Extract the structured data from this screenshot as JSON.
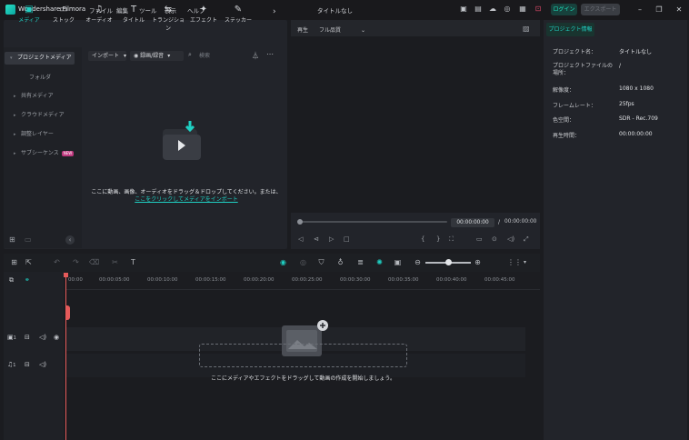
{
  "app": {
    "name": "Wondershare Filmora",
    "menu": [
      "ファイル",
      "編集",
      "ツール",
      "表示",
      "ヘルプ"
    ],
    "doc_title": "タイトルなし",
    "login_label": "ログイン",
    "export_label": "エクスポート",
    "brand_color": "#1fd0c3"
  },
  "toolbar_tabs": [
    {
      "label": "メディア",
      "icon": "media-icon"
    },
    {
      "label": "ストック",
      "icon": "stock-icon"
    },
    {
      "label": "オーディオ",
      "icon": "audio-icon"
    },
    {
      "label": "タイトル",
      "icon": "title-icon"
    },
    {
      "label": "トランジション",
      "icon": "transition-icon"
    },
    {
      "label": "エフェクト",
      "icon": "effect-icon"
    },
    {
      "label": "ステッカー",
      "icon": "sticker-icon"
    }
  ],
  "sidebar": {
    "items": [
      {
        "label": "プロジェクトメディア"
      },
      {
        "label": "フォルダ"
      },
      {
        "label": "共有メディア"
      },
      {
        "label": "クラウドメディア"
      },
      {
        "label": "調整レイヤー"
      },
      {
        "label": "サブシーケンス"
      }
    ],
    "new_badge": "NEW"
  },
  "media": {
    "import_label": "インポート",
    "record_label": "録画/録音",
    "search_placeholder": "検索",
    "empty_line1": "ここに動画、画像、オーディオをドラッグ＆ドロップしてください。または、",
    "empty_link": "ここをクリックしてメディアをインポート"
  },
  "player": {
    "label": "再生",
    "quality": "フル品質",
    "current_time": "00:00:00:00",
    "separator": "/",
    "total_time": "00:00:00:00"
  },
  "info": {
    "tab_label": "プロジェクト情報",
    "rows": [
      {
        "label": "プロジェクト名：",
        "value": "タイトルなし"
      },
      {
        "label": "プロジェクトファイルの場所：",
        "value": "/"
      },
      {
        "label": "解像度：",
        "value": "1080 x 1080"
      },
      {
        "label": "フレームレート：",
        "value": "25fps"
      },
      {
        "label": "色空間：",
        "value": "SDR - Rec.709"
      },
      {
        "label": "再生時間：",
        "value": "00:00:00:00"
      }
    ]
  },
  "timeline": {
    "ticks": [
      "00:00",
      "00:00:05:00",
      "00:00:10:00",
      "00:00:15:00",
      "00:00:20:00",
      "00:00:25:00",
      "00:00:30:00",
      "00:00:35:00",
      "00:00:40:00",
      "00:00:45:00"
    ],
    "video_track_num": "1",
    "audio_track_num": "1",
    "drop_hint": "ここにメディアやエフェクトをドラッグして動画の作成を開始しましょう。"
  }
}
